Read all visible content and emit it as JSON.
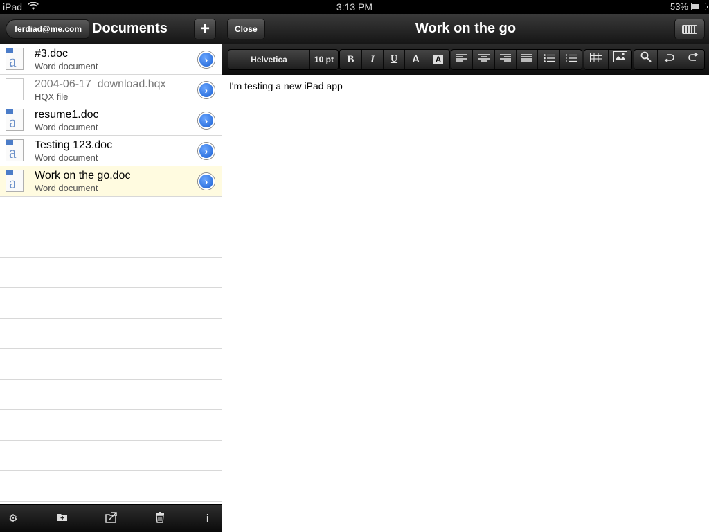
{
  "status_bar": {
    "device": "iPad",
    "time": "3:13 PM",
    "battery": "53%"
  },
  "left": {
    "account_label": "ferdiad@me.com",
    "title": "Documents",
    "add_label": "+",
    "files": [
      {
        "name": "#3.doc",
        "type": "Word document",
        "icon": "word-doc-icon"
      },
      {
        "name": "2004-06-17_download.hqx",
        "type": "HQX file",
        "icon": "blank-file-icon"
      },
      {
        "name": "resume1.doc",
        "type": "Word document",
        "icon": "word-doc-icon"
      },
      {
        "name": "Testing 123.doc",
        "type": "Word document",
        "icon": "word-doc-icon"
      },
      {
        "name": "Work on the go.doc",
        "type": "Word document",
        "icon": "word-doc-icon",
        "selected": true
      }
    ],
    "toolbar": [
      "gear-icon",
      "new-folder-icon",
      "move-icon",
      "trash-icon",
      "info-icon"
    ]
  },
  "right": {
    "close_label": "Close",
    "title": "Work on the go",
    "format": {
      "font": "Helvetica",
      "size": "10 pt"
    },
    "body_text": "I'm testing a new iPad app"
  },
  "colors": {
    "selected_row": "#fffbe0",
    "disclosure": "#1a5fd1"
  }
}
